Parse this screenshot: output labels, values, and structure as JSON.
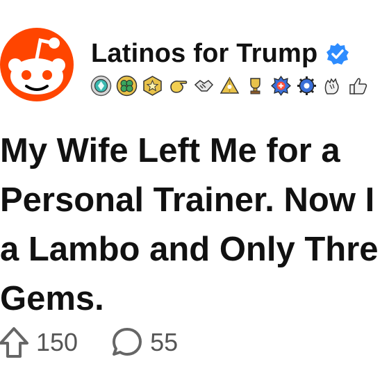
{
  "post": {
    "author": "Latinos for Trump",
    "title_lines": [
      "My Wife Left Me for a",
      "Personal Trainer. Now I",
      "a Lambo and Only Thre",
      "Gems."
    ],
    "upvotes": "150",
    "comments": "55"
  },
  "icons": {
    "avatar": "reddit-snoo-avatar",
    "verified": "verified-check-icon",
    "badges": [
      "diamond-badge",
      "clover-badge",
      "star-badge",
      "pointing-hand-badge",
      "handshake-badge",
      "pyramid-badge",
      "trophy-badge",
      "plus-one-badge",
      "gear-badge",
      "clapping-hands-badge",
      "thumbs-up-badge"
    ],
    "upvote": "upvote-arrow-icon",
    "comment": "comment-bubble-icon"
  },
  "colors": {
    "reddit_orange": "#FF4500",
    "verified_blue": "#2D8CFF",
    "badge_gold": "#E8C24A",
    "muted_text": "#555555"
  }
}
